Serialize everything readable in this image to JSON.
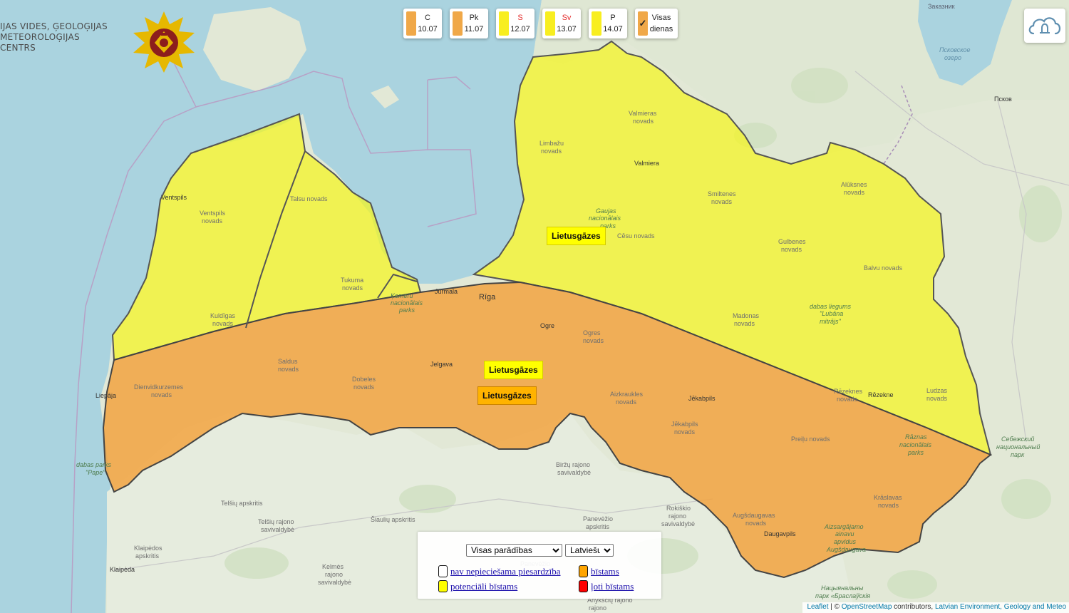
{
  "organization": {
    "line1": "IJAS VIDES, ĢEOLOĢIJAS",
    "line2": "METEOROLOĢIJAS CENTRS"
  },
  "day_buttons": [
    {
      "weekday": "C",
      "date": "10.07",
      "color": "#f0a848",
      "weekday_red": false
    },
    {
      "weekday": "Pk",
      "date": "11.07",
      "color": "#f0a848",
      "weekday_red": false
    },
    {
      "weekday": "S",
      "date": "12.07",
      "color": "#f8ee20",
      "weekday_red": true
    },
    {
      "weekday": "Sv",
      "date": "13.07",
      "color": "#f8ee20",
      "weekday_red": true
    },
    {
      "weekday": "P",
      "date": "14.07",
      "color": "#f8ee20",
      "weekday_red": false
    }
  ],
  "all_days": {
    "label1": "Visas",
    "label2": "dienas",
    "checked": true,
    "color": "#f0a848"
  },
  "warning_tags": [
    {
      "text": "Lietusgāzes",
      "level": "yellow"
    },
    {
      "text": "Lietusgāzes",
      "level": "yellow"
    },
    {
      "text": "Lietusgāzes",
      "level": "orange"
    }
  ],
  "legend": {
    "filter_select": "Visas parādības",
    "language_select": "Latviešu",
    "items": [
      {
        "label": "nav nepieciešama piesardzība",
        "color": "#ffffff"
      },
      {
        "label": "bīstams",
        "color": "#ffa500"
      },
      {
        "label": "potenciāli bīstams",
        "color": "#ffff00"
      },
      {
        "label": "ļoti bīstams",
        "color": "#ff0000"
      }
    ]
  },
  "attribution": {
    "leaflet": "Leaflet",
    "sep": " | © ",
    "osm": "OpenStreetMap",
    "contrib": " contributors, ",
    "lvgmc": "Latvian Environment, Geology and Meteo"
  },
  "map_labels": {
    "cities": [
      "Ventspils",
      "Liepāja",
      "Jūrmala",
      "Rīga",
      "Jelgava",
      "Ogre",
      "Valmiera",
      "Jēkabpils",
      "Daugavpils",
      "Rēzekne",
      "Klaipėda",
      "Псков",
      "Заказник"
    ],
    "regions": [
      "Talsu novads",
      "Ventspils novads",
      "Tukuma novads",
      "Kuldīgas novads",
      "Saldus novads",
      "Dienvidkurzemes novads",
      "Dobeles novads",
      "Ogres novads",
      "Aizkraukles novads",
      "Jēkabpils novads",
      "Preiļu novads",
      "Krāslavas novads",
      "Augšdaugavas novads",
      "Limbažu novads",
      "Valmieras novads",
      "Cēsu novads",
      "Smiltenes novads",
      "Alūksnes novads",
      "Gulbenes novads",
      "Balvu novads",
      "Madonas novads",
      "Rēzeknes novads",
      "Ludzas novads"
    ],
    "parks": [
      "Ķemeru nacionālais parks",
      "Gaujas nacionālais parks",
      "dabas liegums \"Lubāna mitrājs\"",
      "Rāznas nacionālais parks",
      "dabas parks \"Pape\"",
      "Aizsargājamo ainavu apvidus Augšdaugava",
      "Себежский национальный парк",
      "Нацыянальны парк «Браслаўскія"
    ],
    "lithuania": [
      "Telšių apskritis",
      "Telšių rajono savivaldybė",
      "Šiaulių apskritis",
      "Klaipėdos apskritis",
      "Kelmės rajono savivaldybė",
      "Biržų rajono savivaldybė",
      "Panevėžio apskritis",
      "Rokiškio rajono savivaldybė",
      "Anykščių rajono",
      "Panevėžio"
    ],
    "lake": "Псковское озеро"
  }
}
